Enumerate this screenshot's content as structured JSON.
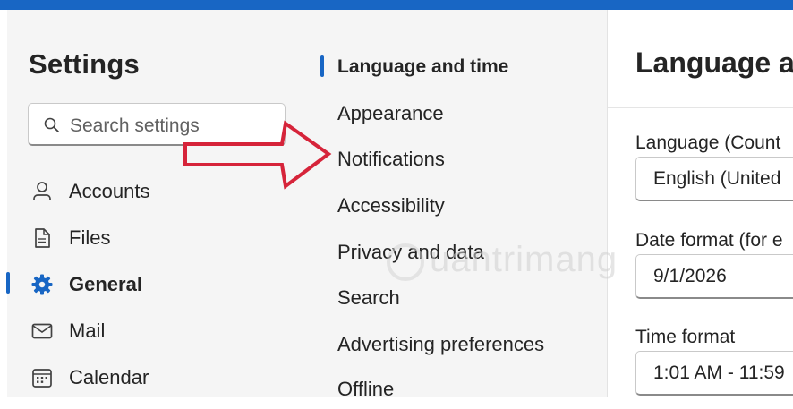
{
  "settings": {
    "title": "Settings",
    "search_placeholder": "Search settings"
  },
  "nav": {
    "items": [
      {
        "label": "Accounts",
        "icon": "person-icon"
      },
      {
        "label": "Files",
        "icon": "file-icon"
      },
      {
        "label": "General",
        "icon": "gear-icon",
        "active": true
      },
      {
        "label": "Mail",
        "icon": "mail-icon"
      },
      {
        "label": "Calendar",
        "icon": "calendar-icon"
      }
    ]
  },
  "subnav": {
    "items": [
      {
        "label": "Language and time",
        "active": true
      },
      {
        "label": "Appearance"
      },
      {
        "label": "Notifications"
      },
      {
        "label": "Accessibility"
      },
      {
        "label": "Privacy and data"
      },
      {
        "label": "Search"
      },
      {
        "label": "Advertising preferences"
      },
      {
        "label": "Offline"
      }
    ]
  },
  "content": {
    "title": "Language a",
    "fields": [
      {
        "label": "Language (Count",
        "value": "English (United"
      },
      {
        "label": "Date format (for e",
        "value": "9/1/2026"
      },
      {
        "label": "Time format",
        "value": "1:01 AM - 11:59"
      }
    ]
  },
  "watermark": {
    "text": "uantrimang"
  },
  "colors": {
    "accent": "#1866c4",
    "arrow": "#d6243a"
  }
}
